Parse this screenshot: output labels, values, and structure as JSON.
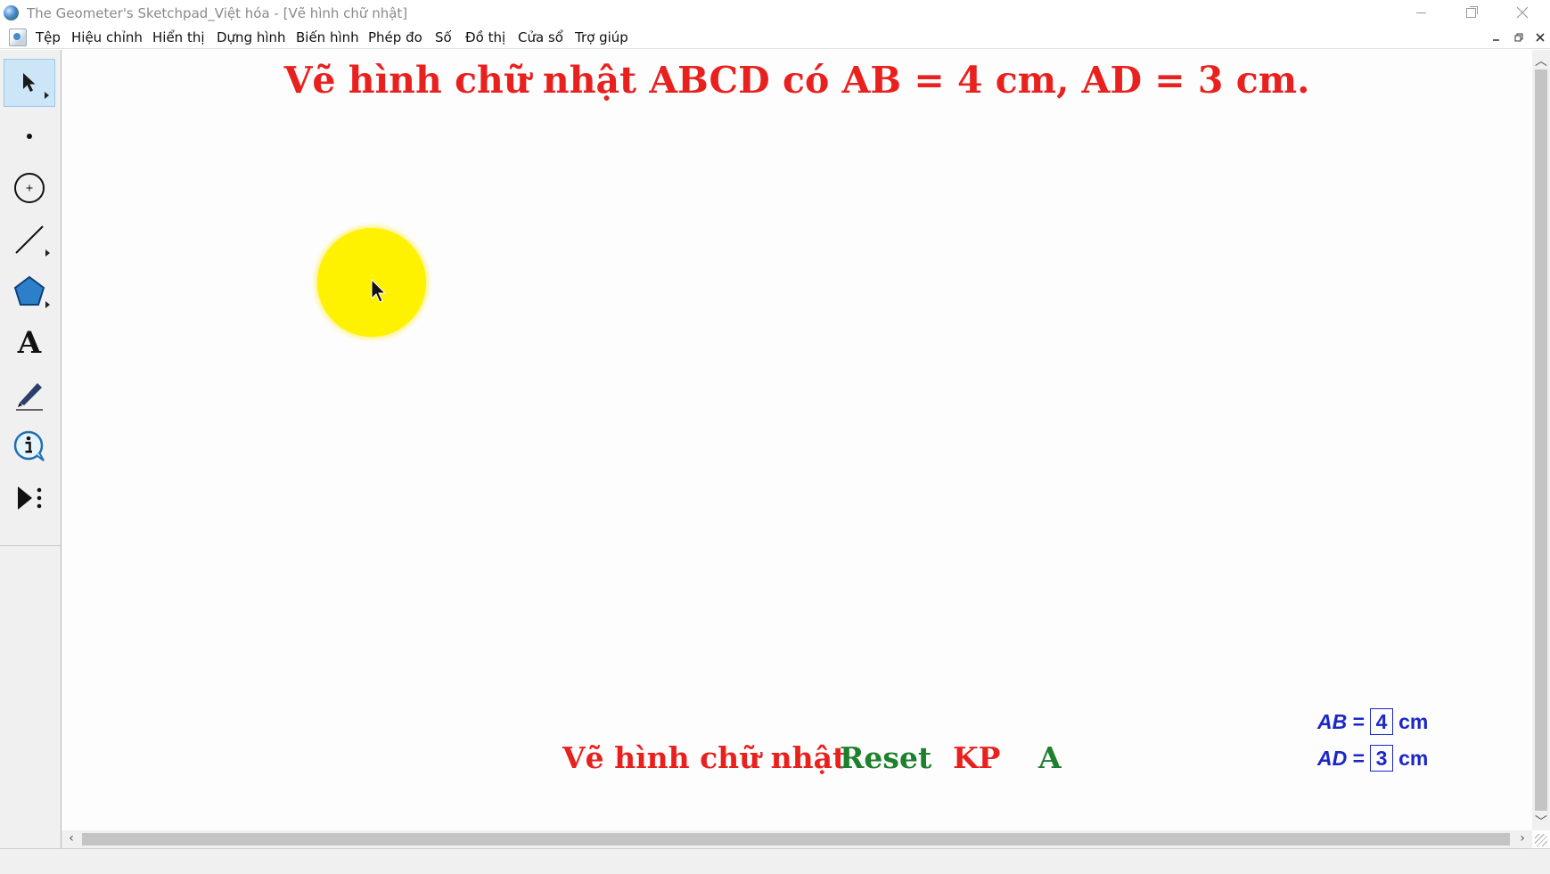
{
  "window": {
    "title": "The Geometer's Sketchpad_Việt hóa - [Vẽ hình chữ nhật]"
  },
  "menu": {
    "items": [
      "Tệp",
      "Hiệu chỉnh",
      "Hiển thị",
      "Dựng hình",
      "Biến hình",
      "Phép đo",
      "Số",
      "Đồ thị",
      "Cửa sổ",
      "Trợ giúp"
    ]
  },
  "toolbox": {
    "tools": [
      "selection-arrow",
      "point",
      "compass",
      "straightedge",
      "polygon",
      "text",
      "marker",
      "information",
      "custom-tools"
    ],
    "text_tool_glyph": "A"
  },
  "canvas": {
    "heading": "Vẽ hình chữ nhật ABCD có AB = 4 cm, AD = 3 cm.",
    "buttons": {
      "draw": "Vẽ hình chữ nhật",
      "reset": "Reset",
      "kp": "KP",
      "a": "A"
    },
    "params": [
      {
        "label": "AB",
        "eq": "=",
        "value": "4",
        "unit": "cm"
      },
      {
        "label": "AD",
        "eq": "=",
        "value": "3",
        "unit": "cm"
      }
    ]
  },
  "colors": {
    "heading": "#e8211f",
    "draw_button": "#e8211f",
    "reset_button": "#1e7f2c",
    "kp_button": "#e8211f",
    "a_button": "#1e7f2c",
    "params": "#1b27c8",
    "cursor_highlight": "#fff200"
  }
}
